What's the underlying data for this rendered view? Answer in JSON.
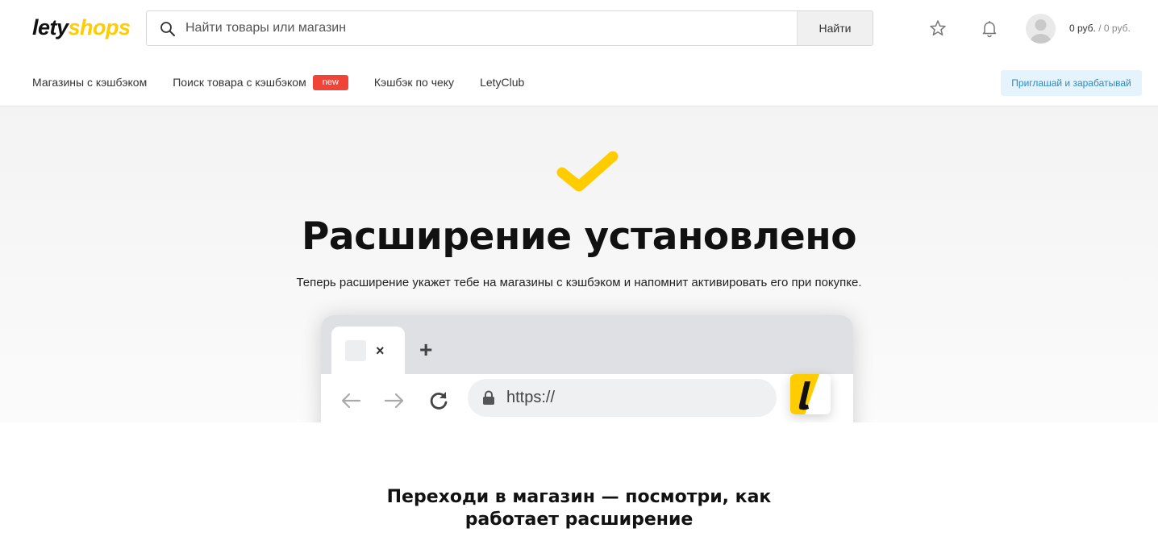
{
  "header": {
    "logo": {
      "part1": "lety",
      "part2": "shops"
    },
    "search": {
      "placeholder": "Найти товары или магазин",
      "button_label": "Найти"
    },
    "icons": [
      "star-icon",
      "bell-icon",
      "user-avatar"
    ],
    "balance": {
      "approved": "0 руб.",
      "separator": "/",
      "pending": "0 руб."
    }
  },
  "nav": {
    "items": [
      {
        "label": "Магазины с кэшбэком"
      },
      {
        "label": "Поиск товара с кэшбэком",
        "badge": "new"
      },
      {
        "label": "Кэшбэк по чеку"
      },
      {
        "label": "LetyClub"
      }
    ],
    "invite_button": "Приглашай и зарабатывай"
  },
  "hero": {
    "title": "Расширение установлено",
    "subtitle": "Теперь расширение укажет тебе на магазины с кэшбэком и напомнит активировать его при покупке.",
    "browser_mock": {
      "tab_close": "×",
      "tab_new": "+",
      "url": "https://",
      "extension_letter": "l"
    }
  },
  "section": {
    "title_line1": "Переходи в магазин — посмотри, как",
    "title_line2": "работает расширение"
  },
  "colors": {
    "brand_yellow": "#ffcc00",
    "badge_red": "#f04438",
    "invite_bg": "#e4f3fc",
    "invite_text": "#2d8ac8"
  }
}
